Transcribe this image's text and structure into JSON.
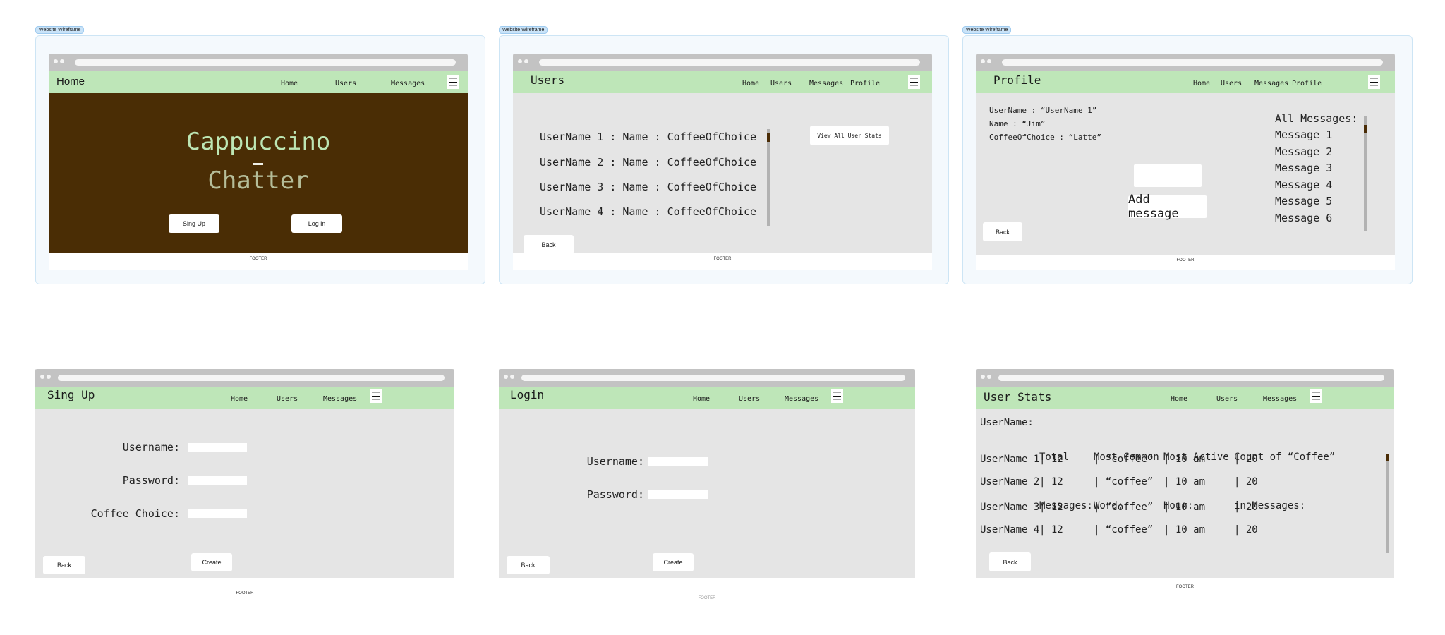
{
  "frame_tag": "Website Wireframe",
  "footer_label": "FOOTER",
  "back_label": "Back",
  "colors": {
    "nav_green": "#bee6b8",
    "coffee_brown": "#4a2d05",
    "title_green": "#bde6b4",
    "title_sage": "#b5bd99",
    "panel_gray": "#e5e5e5"
  },
  "home": {
    "title": "Home",
    "nav": [
      "Home",
      "Users",
      "Messages"
    ],
    "hero_line1": "Cappuccino",
    "hero_dash": "-",
    "hero_line2": "Chatter",
    "signup_button": "Sing Up",
    "login_button": "Log in"
  },
  "users": {
    "title": "Users",
    "nav": [
      "Home",
      "Users",
      "Messages",
      "Profile"
    ],
    "rows": [
      "UserName 1 : Name : CoffeeOfChoice",
      "UserName 2 : Name : CoffeeOfChoice",
      "UserName 3 : Name : CoffeeOfChoice",
      "UserName 4 : Name : CoffeeOfChoice"
    ],
    "view_stats_button": "View All User Stats"
  },
  "profile": {
    "title": "Profile",
    "nav": [
      "Home",
      "Users",
      "Messages",
      "Profile"
    ],
    "fields": [
      "UserName : “UserName 1”",
      "Name : “Jim”",
      "CoffeeOfChoice : “Latte”"
    ],
    "message_input_value": "",
    "add_message_button": "Add message",
    "messages_heading": "All Messages:",
    "messages": [
      "Message 1",
      "Message 2",
      "Message 3",
      "Message 4",
      "Message 5",
      "Message 6"
    ]
  },
  "signup": {
    "title": "Sing Up",
    "nav": [
      "Home",
      "Users",
      "Messages"
    ],
    "username_label": "Username:",
    "password_label": "Password:",
    "coffee_label": "Coffee Choice:",
    "username_value": "",
    "password_value": "",
    "coffee_value": "",
    "create_button": "Create"
  },
  "login": {
    "title": "Login",
    "nav": [
      "Home",
      "Users",
      "Messages"
    ],
    "username_label": "Username:",
    "password_label": "Password:",
    "username_value": "",
    "password_value": "",
    "create_button": "Create"
  },
  "stats": {
    "title": "User Stats",
    "nav": [
      "Home",
      "Users",
      "Messages"
    ],
    "headers": [
      {
        "line1": "UserName:",
        "line2": ""
      },
      {
        "line1": "Total",
        "line2": "Messages:"
      },
      {
        "line1": "Most Common",
        "line2": "Word:"
      },
      {
        "line1": "Most Active",
        "line2": "Hour:"
      },
      {
        "line1": "Count of “Coffee”",
        "line2": "in Messages:"
      }
    ],
    "rows": [
      [
        "UserName 1",
        "| 12",
        "| “coffee”",
        "| 10 am",
        "| 20"
      ],
      [
        "UserName 2",
        "| 12",
        "| “coffee”",
        "| 10 am",
        "| 20"
      ],
      [
        "UserName 3",
        "| 12",
        "| “coffee”",
        "| 10 am",
        "| 20"
      ],
      [
        "UserName 4",
        "| 12",
        "| “coffee”",
        "| 10 am",
        "| 20"
      ]
    ]
  }
}
